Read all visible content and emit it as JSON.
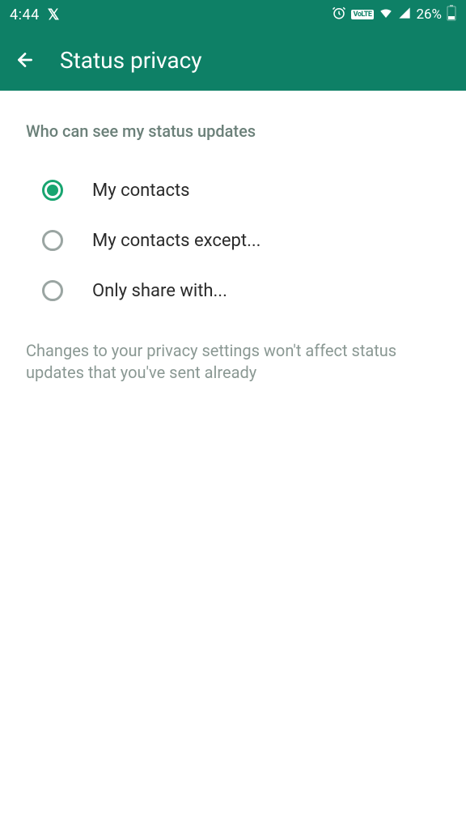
{
  "statusbar": {
    "time": "4:44",
    "battery_pct": "26%"
  },
  "header": {
    "title": "Status privacy"
  },
  "section": {
    "title": "Who can see my status updates"
  },
  "options": [
    {
      "label": "My contacts",
      "selected": true
    },
    {
      "label": "My contacts except...",
      "selected": false
    },
    {
      "label": "Only share with...",
      "selected": false
    }
  ],
  "footer": {
    "note": "Changes to your privacy settings won't affect status updates that you've sent already"
  },
  "colors": {
    "primary": "#0e8066",
    "accent": "#18a570"
  }
}
